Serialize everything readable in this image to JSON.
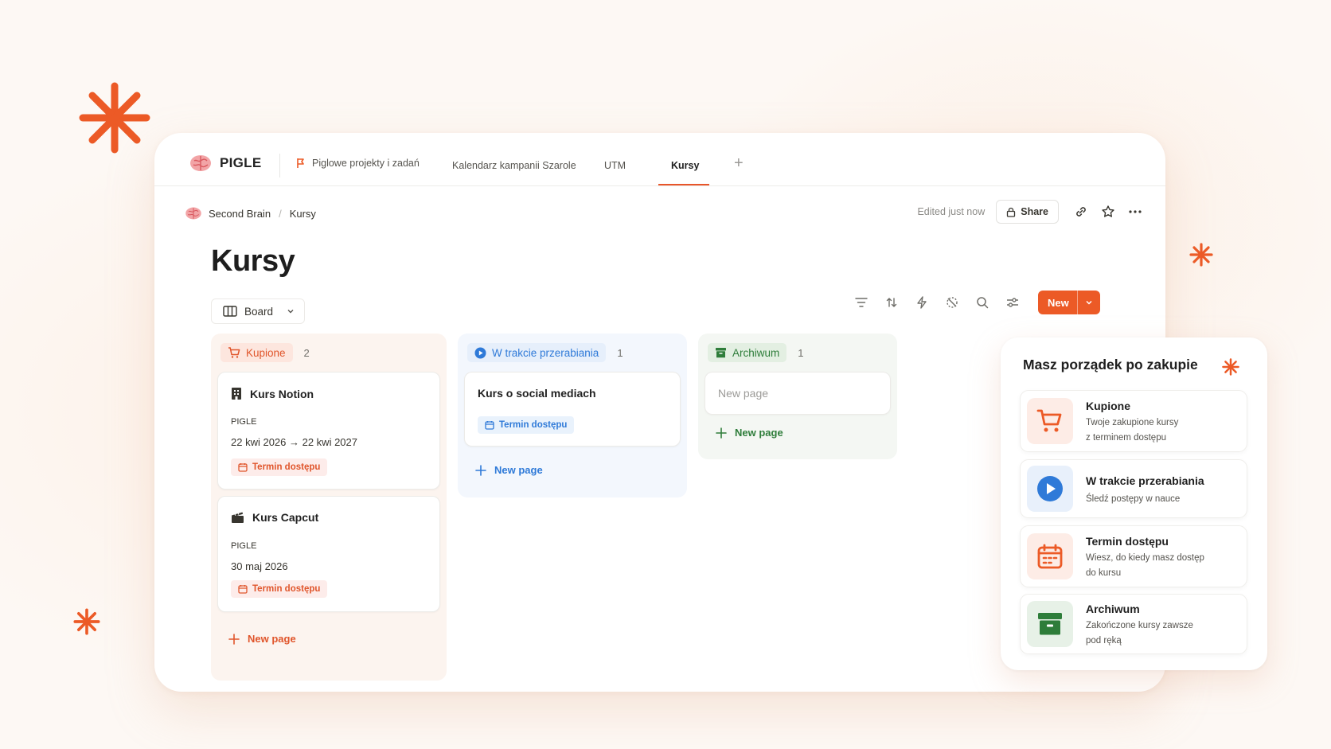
{
  "app": {
    "name": "PIGLE"
  },
  "tabs": [
    {
      "label": "Piglowe projekty i zadań"
    },
    {
      "label": "Kalendarz kampanii Szarole"
    },
    {
      "label": "UTM"
    },
    {
      "label": "Kursy",
      "active": true
    }
  ],
  "breadcrumb": [
    "Second Brain",
    "Kursy"
  ],
  "header": {
    "edited": "Edited just now",
    "share_label": "Share"
  },
  "page": {
    "title": "Kursy"
  },
  "view": {
    "label": "Board"
  },
  "toolbar": {
    "new_label": "New"
  },
  "columns": [
    {
      "name": "Kupione",
      "count": "2",
      "cards": [
        {
          "title": "Kurs Notion",
          "project": "PIGLE",
          "date": "22 kwi 2026 → 22 kwi 2027",
          "tag": "Termin dostępu"
        },
        {
          "title": "Kurs Capcut",
          "project": "PIGLE",
          "date": "30 maj 2026",
          "tag": "Termin dostępu"
        }
      ],
      "new_page": "New page"
    },
    {
      "name": "W trakcie przerabiania",
      "count": "1",
      "cards": [
        {
          "title": "Kurs o social mediach",
          "tag": "Termin dostępu"
        }
      ],
      "new_page": "New page"
    },
    {
      "name": "Archiwum",
      "count": "1",
      "cards": [
        {
          "placeholder": "New page"
        }
      ],
      "new_page": "New page"
    }
  ],
  "panel": {
    "title": "Masz porządek po zakupie",
    "items": [
      {
        "name": "Kupione",
        "desc1": "Twoje zakupione kursy",
        "desc2": "z terminem dostępu"
      },
      {
        "name": "W trakcie przerabiania",
        "desc1": "Śledź postępy w nauce",
        "desc2": ""
      },
      {
        "name": "Termin dostępu",
        "desc1": "Wiesz, do kiedy masz dostęp",
        "desc2": "do kursu"
      },
      {
        "name": "Archiwum",
        "desc1": "Zakończone kursy zawsze",
        "desc2": "pod ręką"
      }
    ]
  },
  "colors": {
    "accent": "#ec5a26",
    "blue": "#2f7ad8",
    "green": "#2e7d3a",
    "background": "#fdf8f4"
  }
}
